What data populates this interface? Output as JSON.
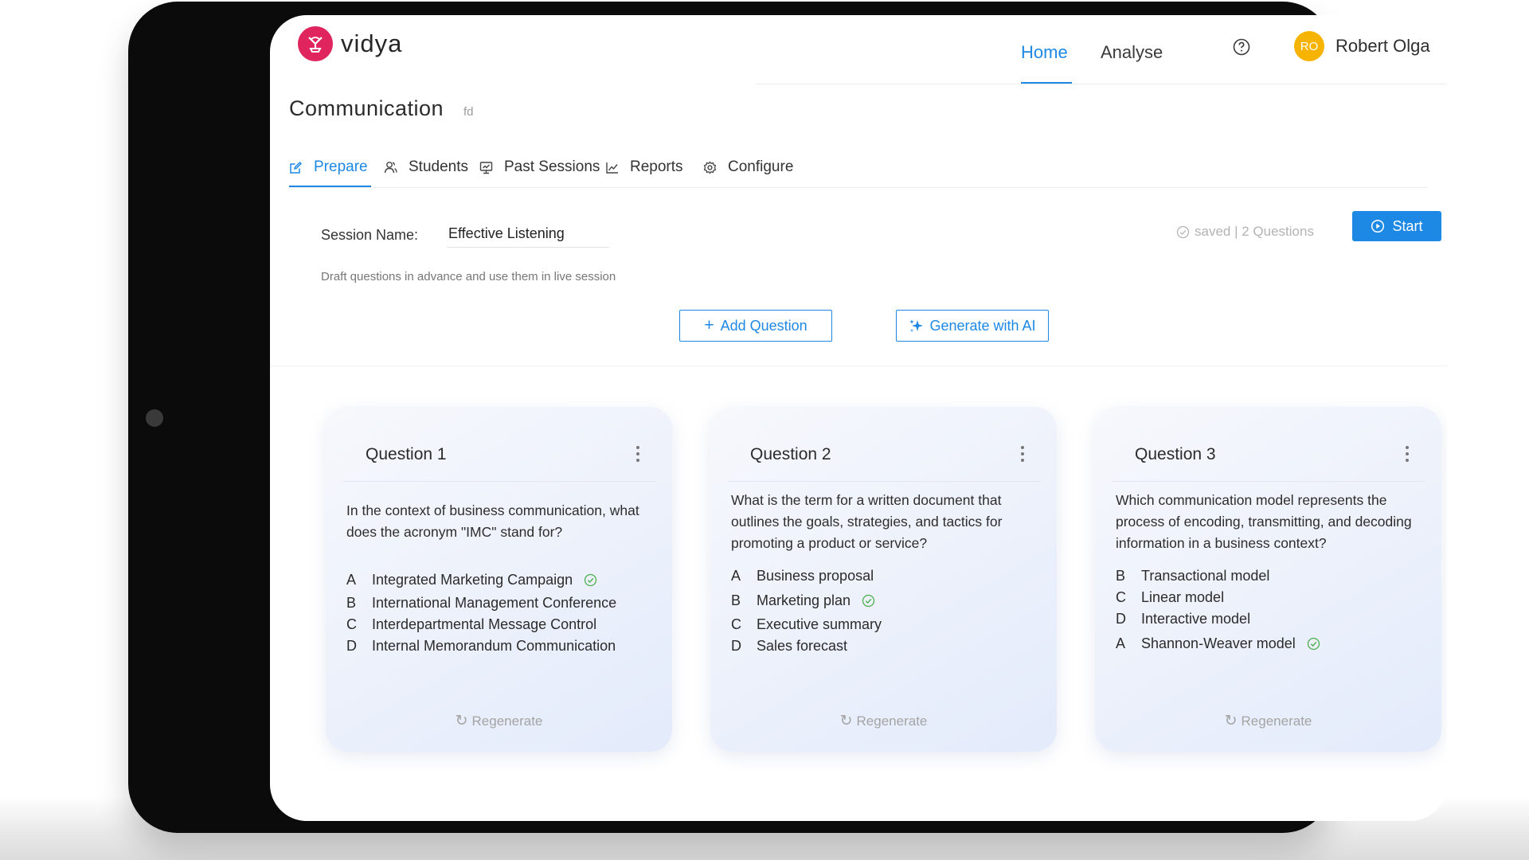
{
  "app": {
    "brand": "vidya",
    "nav": {
      "home": "Home",
      "analyse": "Analyse"
    },
    "user": {
      "initials": "RO",
      "name": "Robert Olga"
    }
  },
  "page": {
    "title": "Communication",
    "code": "fd"
  },
  "tabs": [
    {
      "label": "Prepare",
      "icon": "edit-icon",
      "active": true
    },
    {
      "label": "Students",
      "icon": "students-icon"
    },
    {
      "label": "Past Sessions",
      "icon": "past-sessions-icon"
    },
    {
      "label": "Reports",
      "icon": "chart-line-icon"
    },
    {
      "label": "Configure",
      "icon": "gear-icon"
    }
  ],
  "session": {
    "name_label": "Session Name:",
    "name_value": "Effective Listening",
    "status": "saved | 2 Questions",
    "start_label": "Start",
    "helper": "Draft questions in advance and use them in live session",
    "add_label": "Add Question",
    "generate_label": "Generate with AI"
  },
  "questions": [
    {
      "title": "Question 1",
      "text": "In the context of business communication, what does the acronym \"IMC\" stand for?",
      "options": [
        {
          "letter": "A",
          "text": "Integrated Marketing Campaign",
          "correct": true
        },
        {
          "letter": "B",
          "text": "International Management Conference"
        },
        {
          "letter": "C",
          "text": "Interdepartmental Message Control"
        },
        {
          "letter": "D",
          "text": "Internal Memorandum Communication"
        }
      ],
      "regenerate": "Regenerate"
    },
    {
      "title": "Question 2",
      "text": "What is the term for a written document that outlines the goals, strategies, and tactics for promoting a product or service?",
      "options": [
        {
          "letter": "A",
          "text": "Business proposal"
        },
        {
          "letter": "B",
          "text": "Marketing plan",
          "correct": true
        },
        {
          "letter": "C",
          "text": "Executive summary"
        },
        {
          "letter": "D",
          "text": "Sales forecast"
        }
      ],
      "regenerate": "Regenerate"
    },
    {
      "title": "Question 3",
      "text": "Which communication model represents the process of encoding, transmitting, and decoding information in a business context?",
      "options": [
        {
          "letter": "B",
          "text": "Transactional model"
        },
        {
          "letter": "C",
          "text": "Linear model"
        },
        {
          "letter": "D",
          "text": "Interactive model"
        },
        {
          "letter": "A",
          "text": "Shannon-Weaver model",
          "correct": true
        }
      ],
      "regenerate": "Regenerate"
    }
  ],
  "colors": {
    "accent": "#1e88e5",
    "brand": "#e0245e",
    "avatar": "#f6b300",
    "correct": "#4caf50"
  }
}
